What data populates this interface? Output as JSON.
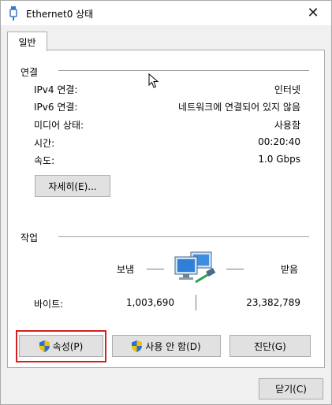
{
  "window": {
    "title": "Ethernet0 상태",
    "close_glyph": "✕"
  },
  "tabs": [
    {
      "label": "일반"
    }
  ],
  "connection": {
    "heading": "연결",
    "rows": [
      {
        "label": "IPv4 연결:",
        "value": "인터넷"
      },
      {
        "label": "IPv6 연결:",
        "value": "네트워크에 연결되어 있지 않음"
      },
      {
        "label": "미디어 상태:",
        "value": "사용함"
      },
      {
        "label": "시간:",
        "value": "00:20:40"
      },
      {
        "label": "속도:",
        "value": "1.0 Gbps"
      }
    ],
    "details_button": "자세히(E)..."
  },
  "activity": {
    "heading": "작업",
    "sent_label": "보냄",
    "received_label": "받음",
    "bytes_label": "바이트:",
    "bytes_sent": "1,003,690",
    "bytes_received": "23,382,789"
  },
  "actions": {
    "properties_button": "속성(P)",
    "disable_button": "사용 안 함(D)",
    "diagnose_button": "진단(G)"
  },
  "footer": {
    "close_button": "닫기(C)"
  },
  "colors": {
    "highlight": "#d42020",
    "button_face": "#e1e1e1",
    "shield_blue": "#2a6fd6",
    "shield_yellow": "#f2c200"
  },
  "icons": {
    "title": "ethernet-icon",
    "network": "network-computers-icon",
    "shield": "uac-shield-icon"
  }
}
